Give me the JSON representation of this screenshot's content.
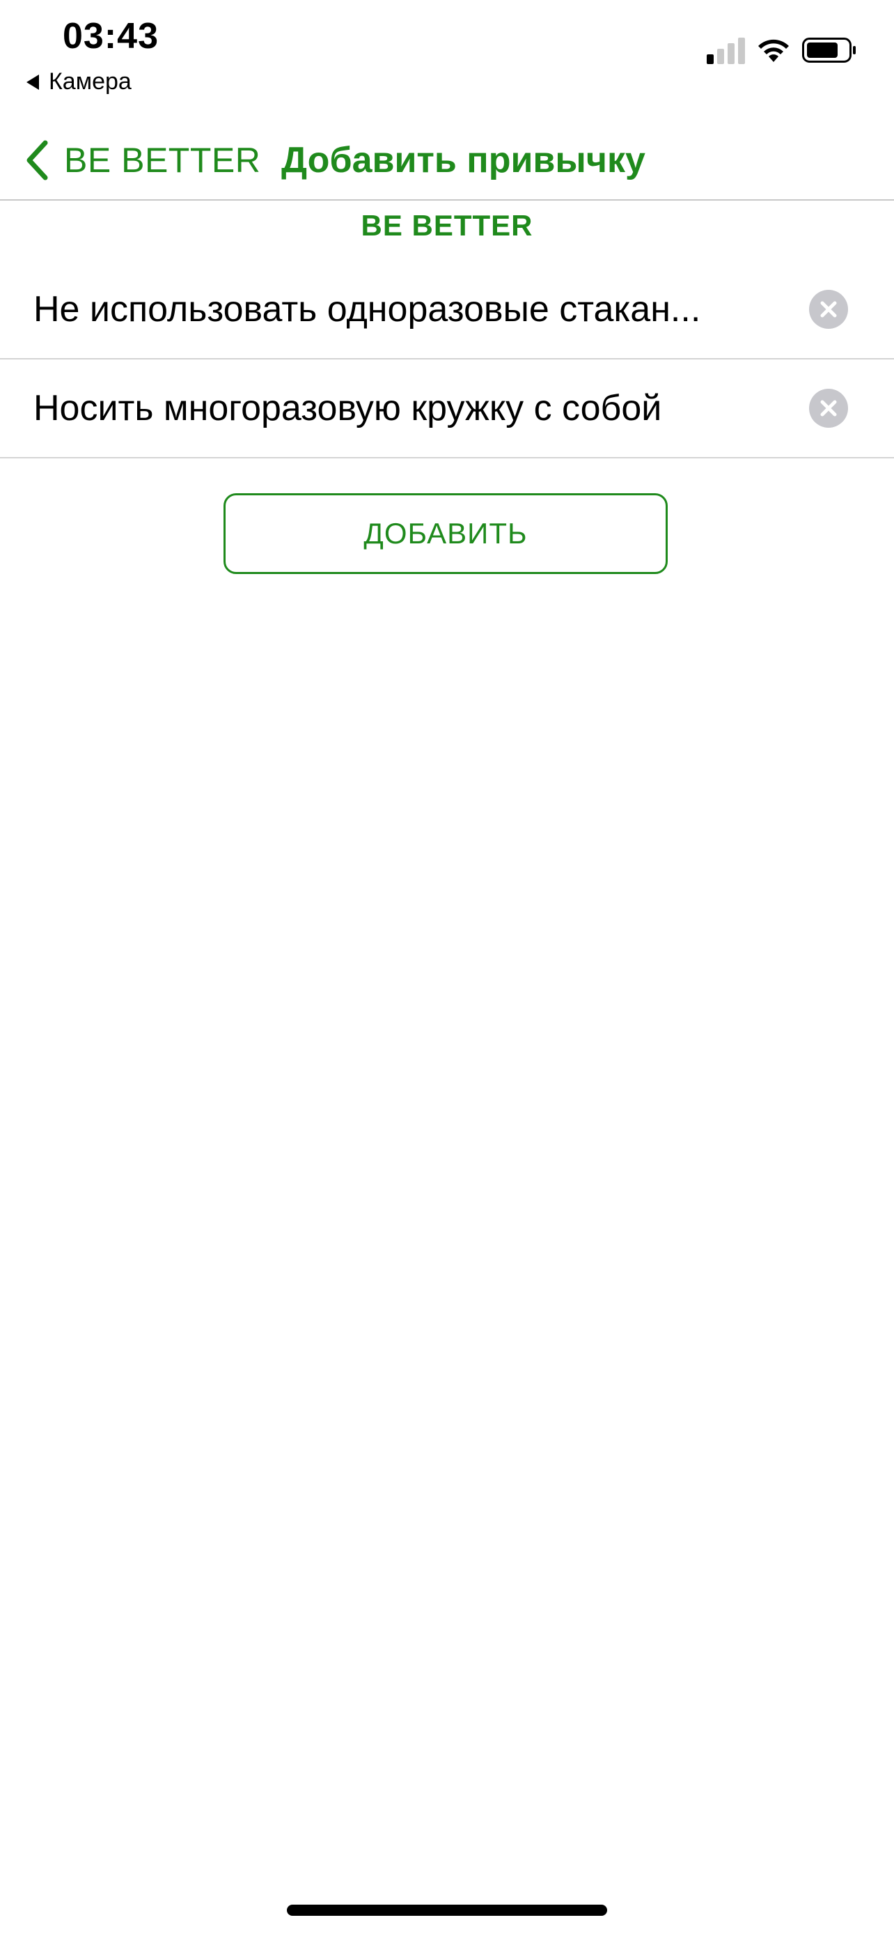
{
  "status_bar": {
    "time": "03:43",
    "back_app": "Камера",
    "signal_bars_active": 1,
    "signal_bars_total": 4
  },
  "nav": {
    "back_label": "BE BETTER",
    "title": "Добавить привычку"
  },
  "section": {
    "header": "BE BETTER"
  },
  "habits": [
    {
      "text": "Не использовать одноразовые стакан..."
    },
    {
      "text": "Носить многоразовую кружку с собой"
    }
  ],
  "actions": {
    "add_label": "ДОБАВИТЬ"
  },
  "colors": {
    "accent": "#1f8a1c",
    "separator": "#d4d4d4",
    "clear_icon_bg": "#c7c7cc"
  },
  "icons": {
    "back": "chevron-left-icon",
    "clear": "clear-circle-icon",
    "wifi": "wifi-icon",
    "battery": "battery-icon",
    "signal": "cellular-signal-icon"
  }
}
